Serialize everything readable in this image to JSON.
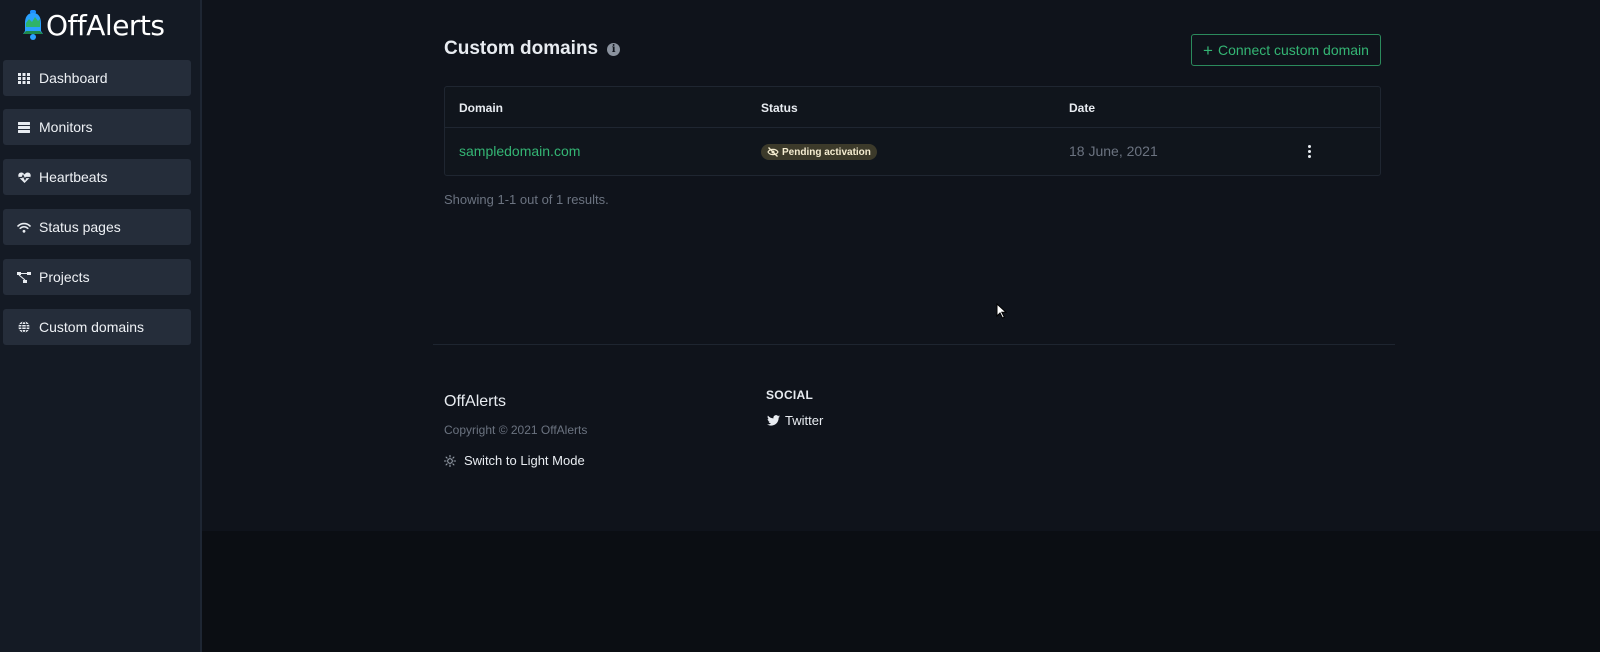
{
  "brand": {
    "logo_text": "OffAlerts"
  },
  "sidebar": {
    "items": [
      {
        "label": "Dashboard",
        "icon": "grid-icon"
      },
      {
        "label": "Monitors",
        "icon": "server-icon"
      },
      {
        "label": "Heartbeats",
        "icon": "heartbeat-icon"
      },
      {
        "label": "Status pages",
        "icon": "wifi-icon"
      },
      {
        "label": "Projects",
        "icon": "project-diagram-icon"
      },
      {
        "label": "Custom domains",
        "icon": "globe-icon"
      }
    ]
  },
  "page": {
    "title": "Custom domains",
    "connect_button": "Connect custom domain",
    "table": {
      "headers": [
        "Domain",
        "Status",
        "Date"
      ],
      "rows": [
        {
          "domain": "sampledomain.com",
          "status": "Pending activation",
          "date": "18 June, 2021"
        }
      ]
    },
    "showing": "Showing 1-1 out of 1 results."
  },
  "footer": {
    "brand": "OffAlerts",
    "copyright": "Copyright © 2021 OffAlerts",
    "switch_mode": "Switch to Light Mode",
    "social_heading": "SOCIAL",
    "twitter": "Twitter"
  },
  "colors": {
    "accent": "#34b574",
    "background": "#0f131b",
    "sidebar": "#141a24",
    "nav_item": "#252d3a",
    "badge_bg": "#3c3a2a"
  }
}
